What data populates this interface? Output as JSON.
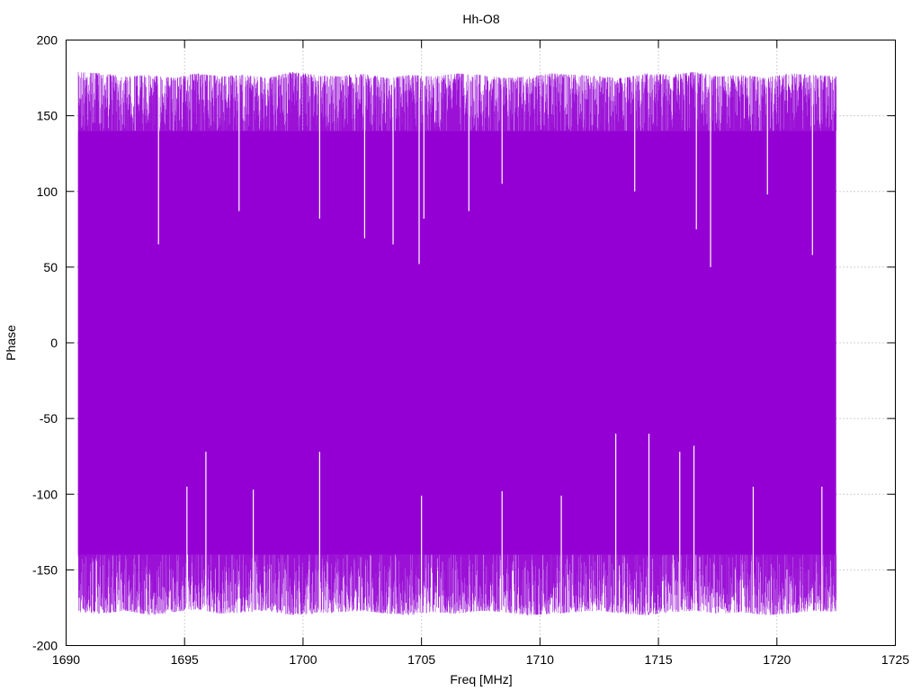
{
  "chart_data": {
    "type": "line",
    "title": "Hh-O8",
    "xlabel": "Freq [MHz]",
    "ylabel": "Phase",
    "xlim": [
      1690,
      1725
    ],
    "ylim": [
      -200,
      200
    ],
    "x_ticks": [
      1690,
      1695,
      1700,
      1705,
      1710,
      1715,
      1720,
      1725
    ],
    "y_ticks": [
      -200,
      -150,
      -100,
      -50,
      0,
      50,
      100,
      150,
      200
    ],
    "grid": true,
    "legend": "none",
    "series": [
      {
        "color": "#9400d3",
        "x_range": [
          1690.5,
          1722.5
        ],
        "envelope_upper": [
          179,
          178,
          176,
          177,
          175,
          178,
          176,
          177,
          175,
          179,
          177,
          176,
          178,
          175,
          177,
          176,
          178,
          177,
          175,
          176,
          178,
          177,
          176,
          175,
          178,
          177,
          179,
          176,
          177,
          175,
          178,
          177,
          176
        ],
        "envelope_lower": [
          -178,
          -179,
          -177,
          -180,
          -178,
          -176,
          -179,
          -178,
          -177,
          -180,
          -179,
          -178,
          -177,
          -179,
          -180,
          -178,
          -179,
          -177,
          -178,
          -180,
          -179,
          -178,
          -177,
          -179,
          -180,
          -178,
          -177,
          -179,
          -178,
          -180,
          -179,
          -177,
          -178
        ],
        "notable_dips_from_top": [
          {
            "x": 1693.9,
            "y": 65
          },
          {
            "x": 1697.3,
            "y": 87
          },
          {
            "x": 1700.7,
            "y": 82
          },
          {
            "x": 1702.6,
            "y": 69
          },
          {
            "x": 1703.8,
            "y": 65
          },
          {
            "x": 1704.9,
            "y": 52
          },
          {
            "x": 1705.1,
            "y": 82
          },
          {
            "x": 1707.0,
            "y": 87
          },
          {
            "x": 1708.4,
            "y": 105
          },
          {
            "x": 1714.0,
            "y": 100
          },
          {
            "x": 1716.6,
            "y": 75
          },
          {
            "x": 1717.2,
            "y": 50
          },
          {
            "x": 1719.6,
            "y": 98
          },
          {
            "x": 1721.5,
            "y": 58
          }
        ],
        "notable_spikes_from_bottom": [
          {
            "x": 1695.1,
            "y": -95
          },
          {
            "x": 1695.9,
            "y": -72
          },
          {
            "x": 1697.9,
            "y": -97
          },
          {
            "x": 1700.7,
            "y": -72
          },
          {
            "x": 1705.0,
            "y": -101
          },
          {
            "x": 1708.4,
            "y": -98
          },
          {
            "x": 1710.9,
            "y": -101
          },
          {
            "x": 1713.2,
            "y": -60
          },
          {
            "x": 1714.6,
            "y": -60
          },
          {
            "x": 1715.9,
            "y": -72
          },
          {
            "x": 1716.5,
            "y": -68
          },
          {
            "x": 1719.0,
            "y": -95
          },
          {
            "x": 1721.9,
            "y": -95
          }
        ]
      }
    ]
  }
}
